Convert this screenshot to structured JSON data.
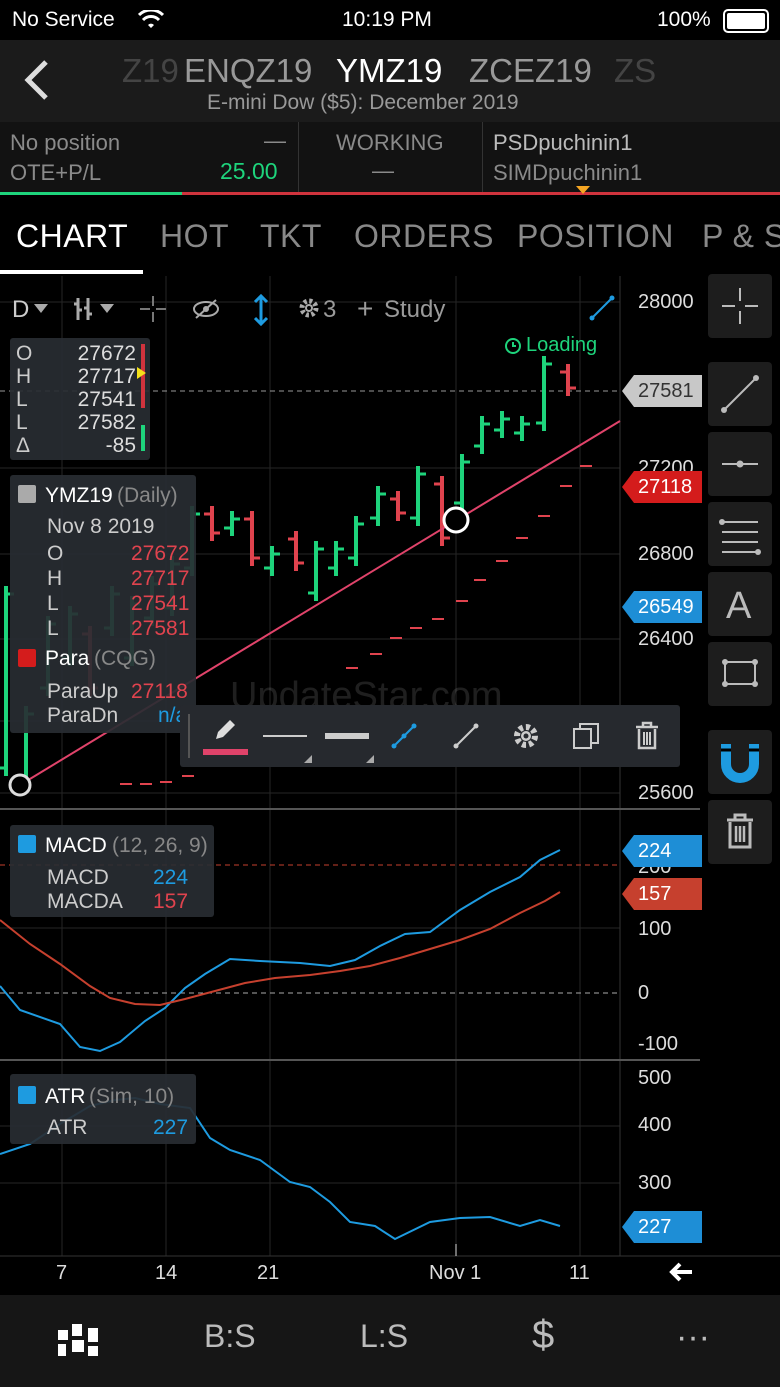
{
  "status": {
    "carrier": "No Service",
    "time": "10:19 PM",
    "battery": "100%"
  },
  "header": {
    "symbols": [
      "Z19",
      "ENQZ19",
      "YMZ19",
      "ZCEZ19",
      "ZS"
    ],
    "active": "YMZ19",
    "subtitle": "E-mini Dow ($5): December 2019"
  },
  "position": {
    "no_position": "No position",
    "dash": "—",
    "ote_label": "OTE+P/L",
    "ote_value": "25.00",
    "working_label": "WORKING",
    "account_1": "PSDpuchinin1",
    "account_2": "SIMDpuchinin1"
  },
  "tabs": [
    "CHART",
    "HOT",
    "TKT",
    "ORDERS",
    "POSITION",
    "P & S"
  ],
  "active_tab": "CHART",
  "toolbar": {
    "interval": "D",
    "study_count": "3",
    "study_label": "Study",
    "loading": "Loading"
  },
  "ohlc": [
    {
      "k": "O",
      "v": "27672"
    },
    {
      "k": "H",
      "v": "27717"
    },
    {
      "k": "L",
      "v": "27541"
    },
    {
      "k": "L",
      "v": "27582"
    },
    {
      "k": "Δ",
      "v": "-85"
    }
  ],
  "info": {
    "symbol": "YMZ19",
    "period": "(Daily)",
    "date": "Nov 8 2019",
    "rows": [
      {
        "k": "O",
        "v": "27672"
      },
      {
        "k": "H",
        "v": "27717"
      },
      {
        "k": "L",
        "v": "27541"
      },
      {
        "k": "L",
        "v": "27581"
      }
    ],
    "para": "Para",
    "para_src": "(CQG)",
    "para_up_label": "ParaUp",
    "para_up": "27118",
    "para_dn_label": "ParaDn",
    "para_dn": "n/a"
  },
  "macd": {
    "name": "MACD",
    "params": "(12, 26, 9)",
    "macd_label": "MACD",
    "macd_val": "224",
    "macda_label": "MACDA",
    "macda_val": "157"
  },
  "atr": {
    "name": "ATR",
    "params": "(Sim, 10)",
    "atr_label": "ATR",
    "atr_val": "227"
  },
  "price_axis": [
    "28000",
    "27200",
    "26800",
    "26400",
    "25600"
  ],
  "price_tags": {
    "last": "27581",
    "para": "27118",
    "low": "26549"
  },
  "macd_axis": [
    "200",
    "100",
    "0",
    "-100"
  ],
  "macd_tags": {
    "macd": "224",
    "macda": "157"
  },
  "atr_axis": [
    "500",
    "400",
    "300"
  ],
  "atr_tag": "227",
  "x_axis": [
    "7",
    "14",
    "21",
    "Nov 1",
    "11"
  ],
  "watermark": "UpdateStar.com",
  "bottom_nav": [
    "B:S",
    "L:S",
    "$",
    "···"
  ],
  "colors": {
    "up": "#1ed47c",
    "down": "#e0434e",
    "macd": "#1e9be0",
    "macda": "#c6402e",
    "accent": "#f5a623"
  }
}
